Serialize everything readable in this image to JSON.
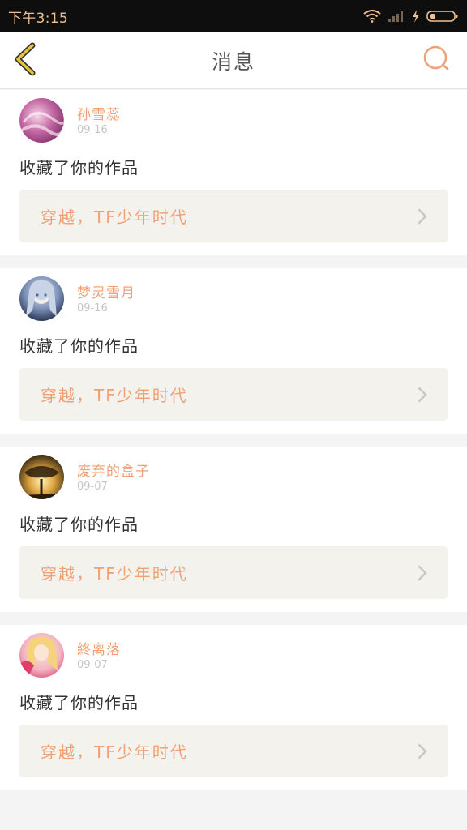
{
  "status_bar": {
    "time": "下午3:15"
  },
  "nav": {
    "title": "消息"
  },
  "messages": [
    {
      "user": "孙雪蕊",
      "date": "09-16",
      "action": "收藏了你的作品",
      "work_title": "穿越，TF少年时代"
    },
    {
      "user": "梦灵雪月",
      "date": "09-16",
      "action": "收藏了你的作品",
      "work_title": "穿越，TF少年时代"
    },
    {
      "user": "废弃的盒子",
      "date": "09-07",
      "action": "收藏了你的作品",
      "work_title": "穿越，TF少年时代"
    },
    {
      "user": "終离落",
      "date": "09-07",
      "action": "收藏了你的作品",
      "work_title": "穿越，TF少年时代"
    }
  ],
  "colors": {
    "accent": "#f0a074",
    "back_arrow": "#e8c43a",
    "card_link_bg": "#f3f2ec"
  },
  "icons": {
    "back": "chevron-left-icon",
    "search": "search-icon",
    "wifi": "wifi-icon",
    "signal": "signal-icon",
    "charging": "charging-icon",
    "battery": "battery-icon",
    "chevron": "chevron-right-icon"
  }
}
